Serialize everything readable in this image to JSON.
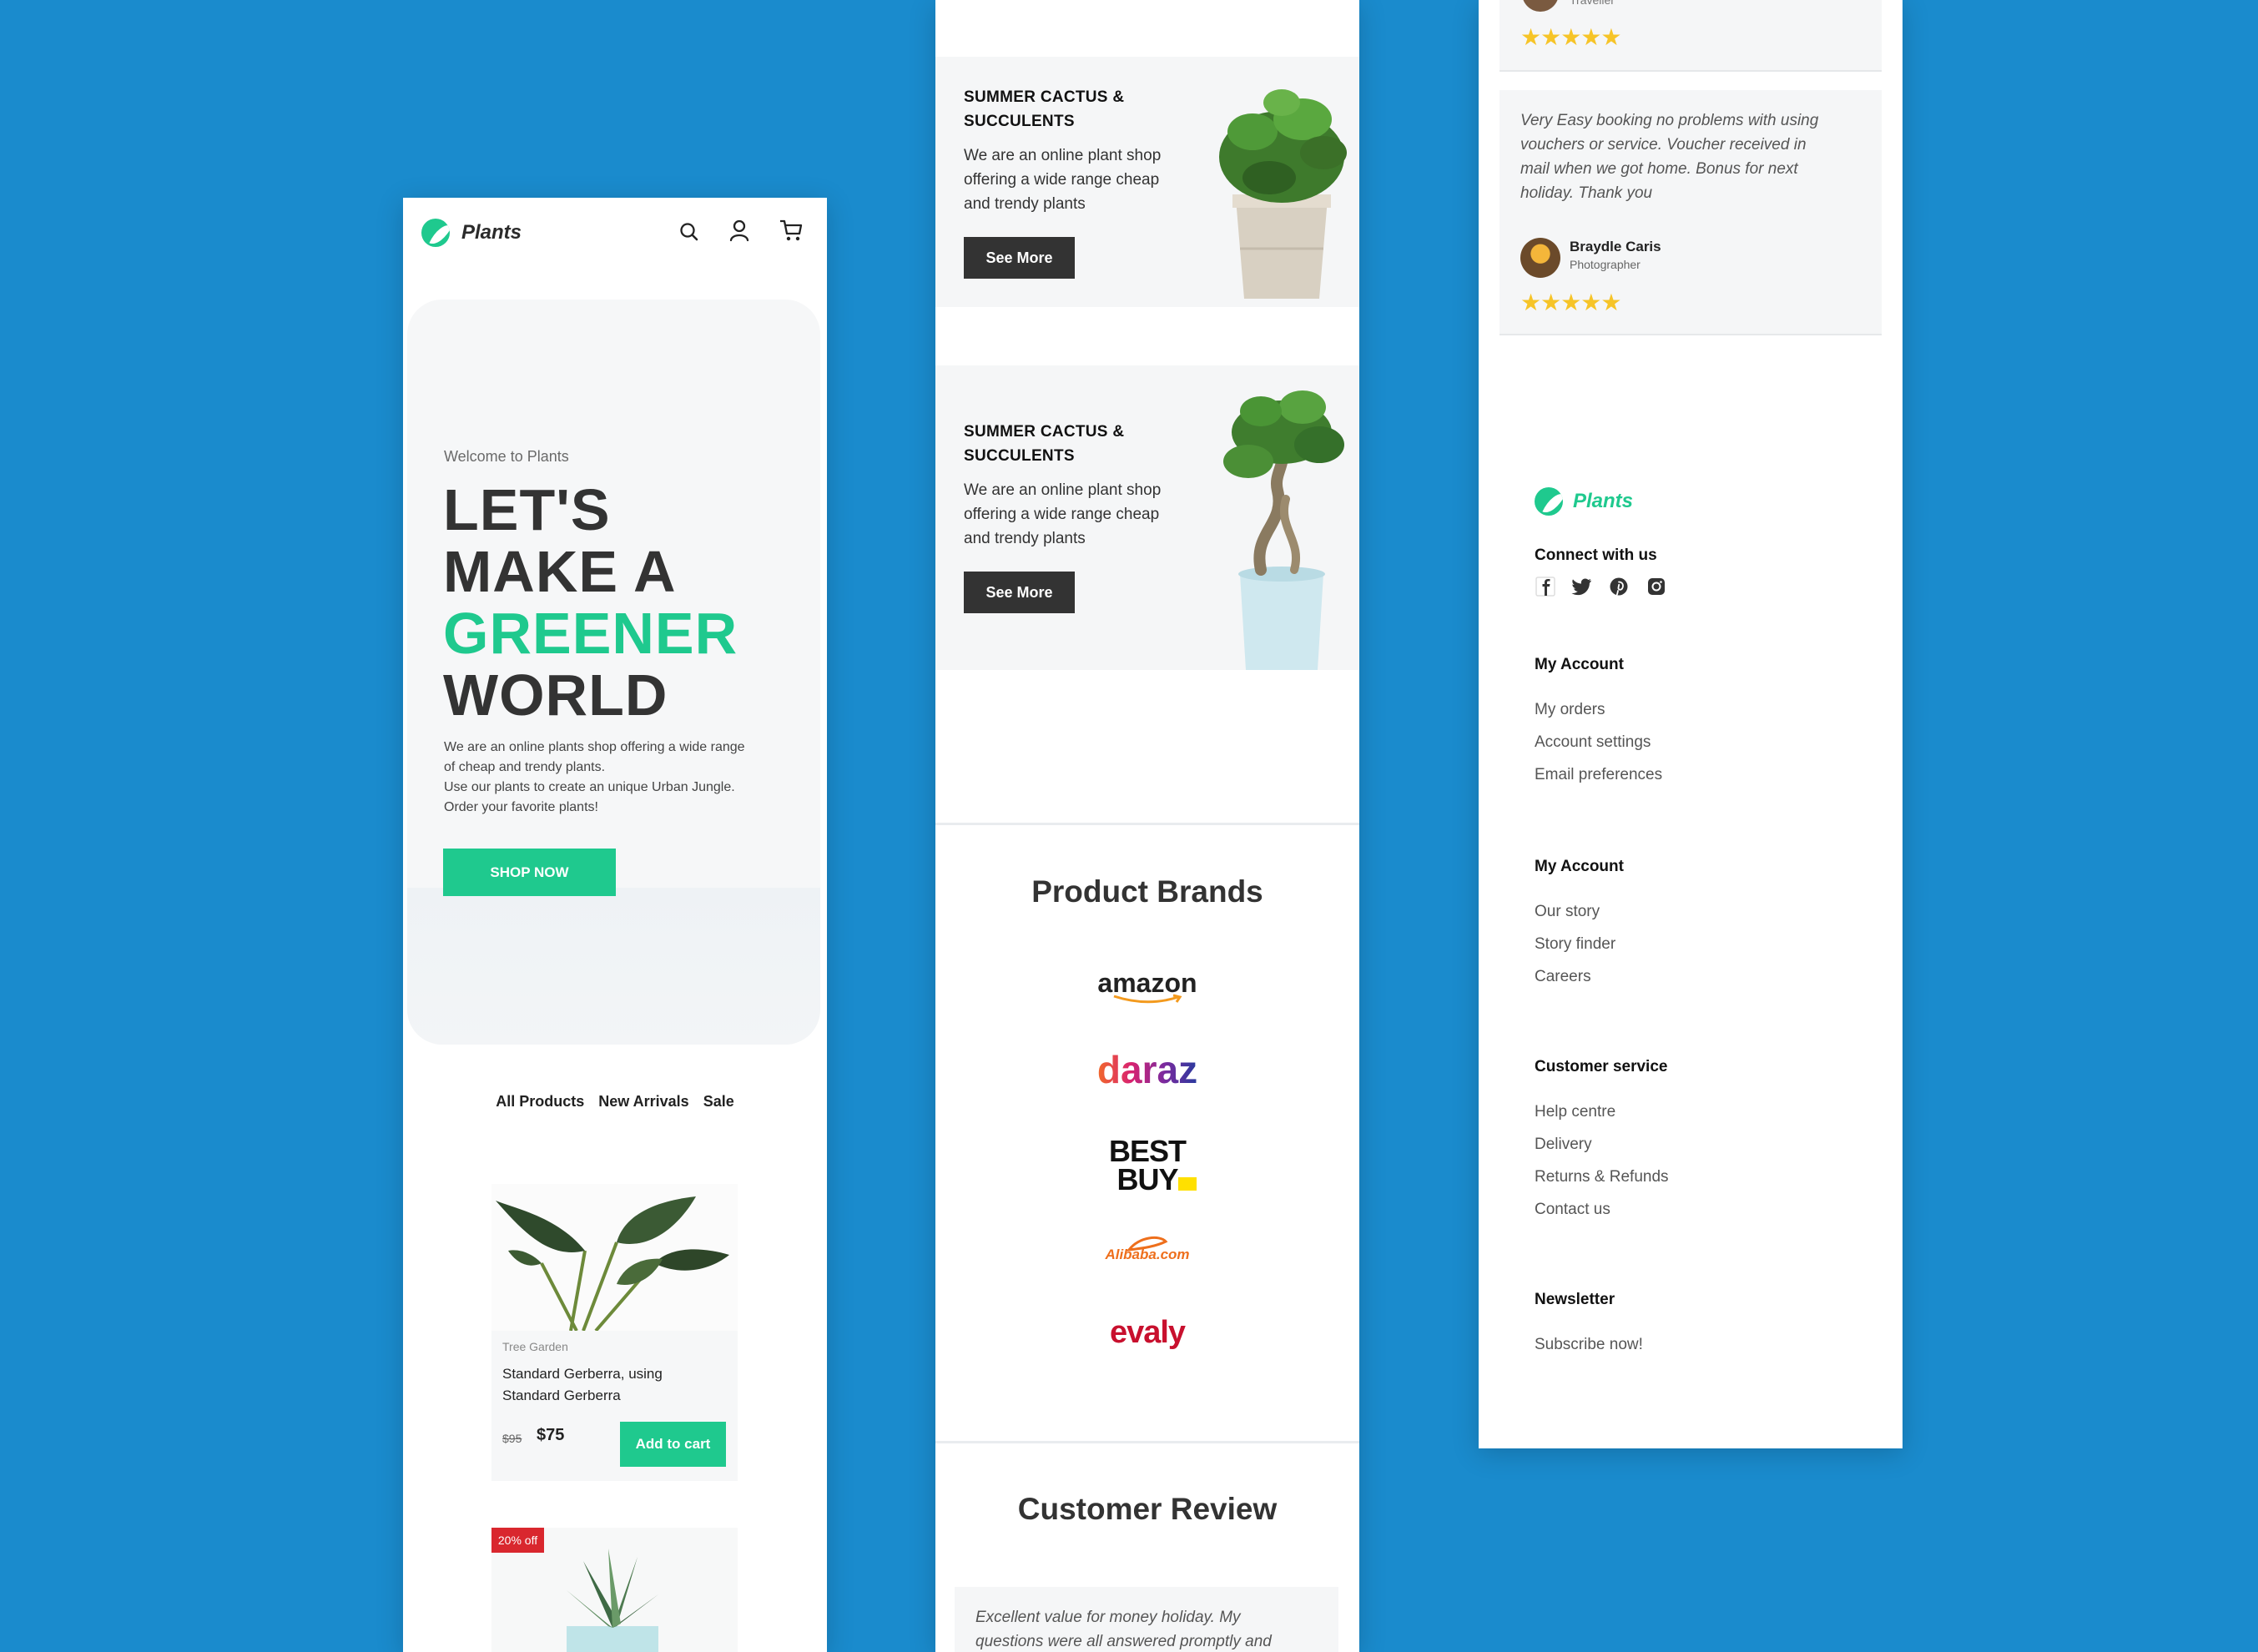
{
  "colors": {
    "background": "#1a8bcd",
    "accent": "#1fc98e",
    "dark_button": "#333333",
    "badge": "#d9272e",
    "star": "#f6c428"
  },
  "header": {
    "logo_text": "Plants",
    "icons": [
      "search-icon",
      "user-icon",
      "cart-icon"
    ]
  },
  "hero": {
    "welcome": "Welcome to Plants",
    "headline_line1": "LET'S",
    "headline_line2": "MAKE A",
    "headline_line3": "GREENER",
    "headline_line4": "WORLD",
    "description_line1": "We are an online plants shop offering a wide range",
    "description_line2": "of cheap and trendy plants.",
    "description_line3": "Use our plants to create an unique Urban Jungle.",
    "description_line4": "Order your favorite plants!",
    "cta": "SHOP NOW"
  },
  "filter_tabs": [
    "All Products",
    "New Arrivals",
    "Sale"
  ],
  "products": [
    {
      "category": "Tree Garden",
      "title_line1": "Standard Gerberra, using",
      "title_line2": "Standard Gerberra",
      "old_price": "$95",
      "price": "$75",
      "button": "Add to cart"
    },
    {
      "badge": "20% off"
    }
  ],
  "promos": [
    {
      "title_line1": "SUMMER CACTUS &",
      "title_line2": "SUCCULENTS",
      "text_line1": "We are an online plant shop",
      "text_line2": "offering a wide range cheap",
      "text_line3": "and trendy plants",
      "button": "See More"
    },
    {
      "title_line1": "SUMMER CACTUS &",
      "title_line2": "SUCCULENTS",
      "text_line1": "We are an online plant shop",
      "text_line2": "offering a wide range cheap",
      "text_line3": "and trendy plants",
      "button": "See More"
    }
  ],
  "brands": {
    "title": "Product Brands",
    "items": [
      "amazon",
      "daraz",
      "BEST",
      "BUY",
      "Alibaba.com",
      "evaly"
    ]
  },
  "reviews": {
    "title": "Customer Review",
    "items": [
      {
        "text_line1": "Excellent value for money holiday. My",
        "text_line2": "questions were all answered promptly and"
      },
      {
        "role": "Traveller",
        "rating": 5
      },
      {
        "text_line1": "Very Easy booking no problems with using",
        "text_line2": "vouchers or service. Voucher received in",
        "text_line3": "mail when we got home. Bonus for next",
        "text_line4": "holiday. Thank you",
        "name": "Braydle Caris",
        "role": "Photographer",
        "rating": 5
      }
    ]
  },
  "footer": {
    "logo_text": "Plants",
    "connect": "Connect with us",
    "social_icons": [
      "facebook-icon",
      "twitter-icon",
      "pinterest-icon",
      "instagram-icon"
    ],
    "sections": [
      {
        "title": "My Account",
        "links": [
          "My orders",
          "Account settings",
          "Email preferences"
        ]
      },
      {
        "title": "My Account",
        "links": [
          "Our story",
          "Story finder",
          "Careers"
        ]
      },
      {
        "title": "Customer service",
        "links": [
          "Help centre",
          "Delivery",
          "Returns & Refunds",
          "Contact us"
        ]
      },
      {
        "title": "Newsletter",
        "links": [
          "Subscribe now!"
        ]
      }
    ]
  }
}
